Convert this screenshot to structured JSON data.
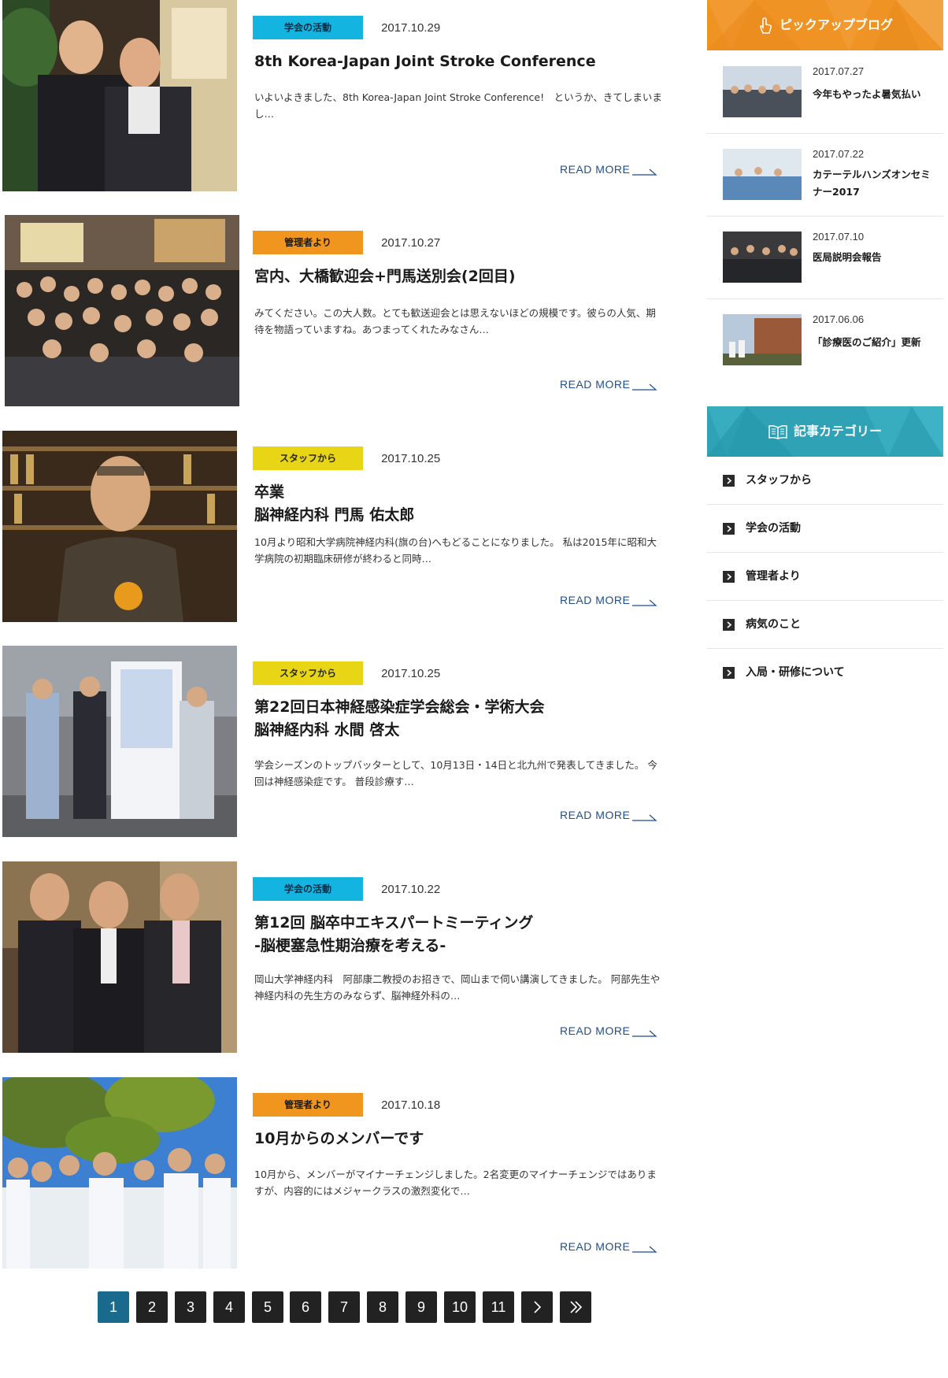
{
  "posts": [
    {
      "category": "学会の活動",
      "category_color": "#13b5e0",
      "date": "2017.10.29",
      "title": "8th Korea-Japan Joint Stroke Conference",
      "excerpt": "いよいよきました、8th Korea-Japan Joint Stroke Conference!　というか、きてしまいまし…",
      "read_more": "READ MORE"
    },
    {
      "category": "管理者より",
      "category_color": "#f0961f",
      "date": "2017.10.27",
      "title": "宮内、大橋歓迎会+門馬送別会(2回目)",
      "excerpt": "みてください。この大人数。とても歓送迎会とは思えないほどの規模です。彼らの人気、期待を物語っていますね。あつまってくれたみなさん…",
      "read_more": "READ MORE"
    },
    {
      "category": "スタッフから",
      "category_color": "#e7d516",
      "date": "2017.10.25",
      "title": "卒業\n脳神経内科 門馬 佑太郎",
      "excerpt": "10月より昭和大学病院神経内科(旗の台)へもどることになりました。 私は2015年に昭和大学病院の初期臨床研修が終わると同時…",
      "read_more": "READ MORE"
    },
    {
      "category": "スタッフから",
      "category_color": "#e7d516",
      "date": "2017.10.25",
      "title": "第22回日本神経感染症学会総会・学術大会\n脳神経内科 水間 啓太",
      "excerpt": "学会シーズンのトップバッターとして、10月13日・14日と北九州で発表してきました。 今回は神経感染症です。 普段診療す…",
      "read_more": "READ MORE"
    },
    {
      "category": "学会の活動",
      "category_color": "#13b5e0",
      "date": "2017.10.22",
      "title": "第12回 脳卒中エキスパートミーティング\n -脳梗塞急性期治療を考える-",
      "excerpt": "岡山大学神経内科　阿部康二教授のお招きで、岡山まで伺い講演してきました。 阿部先生や神経内科の先生方のみならず、脳神経外科の…",
      "read_more": "READ MORE"
    },
    {
      "category": "管理者より",
      "category_color": "#f0961f",
      "date": "2017.10.18",
      "title": "10月からのメンバーです",
      "excerpt": "10月から、メンバーがマイナーチェンジしました。2名変更のマイナーチェンジではありますが、内容的にはメジャークラスの激烈変化で…",
      "read_more": "READ MORE"
    }
  ],
  "pagination": {
    "pages": [
      "1",
      "2",
      "3",
      "4",
      "5",
      "6",
      "7",
      "8",
      "9",
      "10",
      "11"
    ],
    "current": "1",
    "next": "›",
    "last": "»"
  },
  "sidebar": {
    "pickup": {
      "heading": "ピックアップブログ",
      "icon": "pointer-hand-icon",
      "items": [
        {
          "date": "2017.07.27",
          "title": "今年もやったよ暑気払い"
        },
        {
          "date": "2017.07.22",
          "title": "カテーテルハンズオンセミナー2017"
        },
        {
          "date": "2017.07.10",
          "title": "医局説明会報告"
        },
        {
          "date": "2017.06.06",
          "title": "「診療医のご紹介」更新"
        }
      ]
    },
    "categories": {
      "heading": "記事カテゴリー",
      "icon": "book-icon",
      "items": [
        "スタッフから",
        "学会の活動",
        "管理者より",
        "病気のこと",
        "入局・研修について"
      ]
    }
  }
}
